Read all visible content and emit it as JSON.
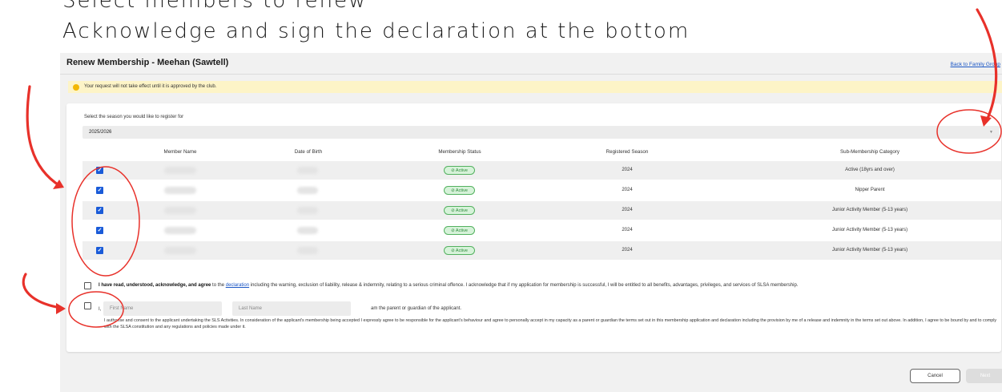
{
  "instructions": {
    "line1": "Select members to renew",
    "line2": "Acknowledge and sign the declaration at the bottom"
  },
  "header": {
    "title": "Renew Membership - Meehan (Sawtell)",
    "back_link": "Back to Family Group"
  },
  "notice": {
    "text": "Your request will not take effect until it is approved by the club.",
    "icon": "warning-icon"
  },
  "season_select": {
    "label": "Select the season you would like to register for",
    "value": "2025/2026"
  },
  "table": {
    "headers": [
      "Member Name",
      "Date of Birth",
      "Membership Status",
      "Registered Season",
      "Sub-Membership Category"
    ],
    "rows": [
      {
        "checked": true,
        "status": "Active",
        "season": "2024",
        "category": "Active (18yrs and over)"
      },
      {
        "checked": true,
        "status": "Active",
        "season": "2024",
        "category": "Nipper Parent"
      },
      {
        "checked": true,
        "status": "Active",
        "season": "2024",
        "category": "Junior Activity Member (5-13 years)"
      },
      {
        "checked": true,
        "status": "Active",
        "season": "2024",
        "category": "Junior Activity Member (5-13 years)"
      },
      {
        "checked": true,
        "status": "Active",
        "season": "2024",
        "category": "Junior Activity Member (5-13 years)"
      }
    ]
  },
  "declaration": {
    "bold": "I have read, understood, acknowledge, and agree",
    "to_the": "to the",
    "link": "declaration",
    "rest": "including the warning, exclusion of liability, release & indemnity, relating to a serious criminal offence. I acknowledge that if my application for membership is successful, I will be entitled to all benefits, advantages, privileges, and services of SLSA membership."
  },
  "guardian": {
    "i_label": "I,",
    "first_name_placeholder": "First Name",
    "last_name_placeholder": "Last Name",
    "text": "am the parent or guardian of the applicant.",
    "consent": "I authorise and consent to the applicant undertaking the SLS Activities. In consideration of the applicant's membership being accepted I expressly agree to be responsible for the applicant's behaviour and agree to personally accept in my capacity as a parent or guardian the terms set out in this membership application and declaration including the provision by me of a release and indemnity in the terms set out above. In addition, I agree to be bound by and to comply with the SLSA constitution and any regulations and policies made under it."
  },
  "buttons": {
    "cancel": "Cancel",
    "next": "Next"
  },
  "colors": {
    "annotation_red": "#e8312a",
    "checkbox_blue": "#1a5bd8",
    "active_green": "#2e8b3a",
    "notice_yellow": "#fdf4c7",
    "link_blue": "#1a56c5"
  }
}
